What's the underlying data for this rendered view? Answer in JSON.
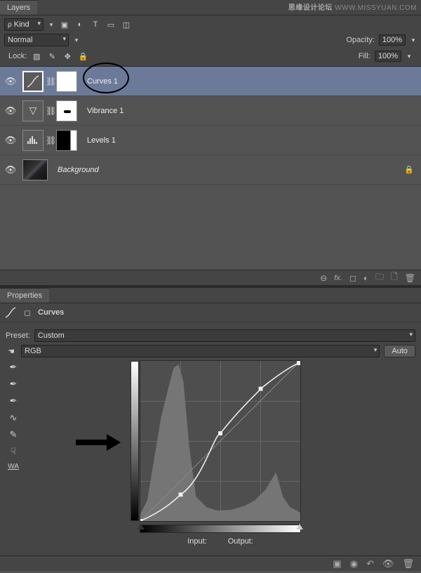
{
  "watermark": {
    "brand": "思缘设计论坛",
    "url": "WWW.MISSYUAN.COM"
  },
  "layers_panel": {
    "tab": "Layers",
    "kind_label": "Kind",
    "filter_icons": [
      "pixel-icon",
      "adjust-icon",
      "type-icon",
      "shape-icon",
      "smart-icon"
    ],
    "blend_mode": "Normal",
    "opacity_label": "Opacity:",
    "opacity_value": "100%",
    "lock_label": "Lock:",
    "fill_label": "Fill:",
    "fill_value": "100%",
    "items": [
      {
        "name": "Curves 1",
        "type": "curves",
        "visible": true,
        "selected": true
      },
      {
        "name": "Vibrance 1",
        "type": "vibrance",
        "visible": true,
        "selected": false
      },
      {
        "name": "Levels 1",
        "type": "levels",
        "visible": true,
        "selected": false
      },
      {
        "name": "Background",
        "type": "image",
        "visible": true,
        "selected": false,
        "locked": true,
        "italic": true
      }
    ],
    "footer_icons": [
      "link-icon",
      "fx-icon",
      "mask-icon",
      "adjustment-icon",
      "group-icon",
      "new-layer-icon",
      "trash-icon"
    ]
  },
  "properties_panel": {
    "tab": "Properties",
    "title": "Curves",
    "preset_label": "Preset:",
    "preset_value": "Custom",
    "channel_value": "RGB",
    "auto_label": "Auto",
    "input_label": "Input:",
    "output_label": "Output:",
    "tool_icons": [
      "target-adjust-icon",
      "sample-black-icon",
      "sample-gray-icon",
      "sample-white-icon",
      "edit-points-icon",
      "draw-curve-icon",
      "hand-icon",
      "clip-icon"
    ],
    "footer_icons": [
      "clip-toggle-icon",
      "view-previous-icon",
      "reset-icon",
      "visibility-icon",
      "trash-icon"
    ]
  },
  "chart_data": {
    "type": "line",
    "title": "Curves",
    "xlabel": "Input",
    "ylabel": "Output",
    "xlim": [
      0,
      255
    ],
    "ylim": [
      0,
      255
    ],
    "series": [
      {
        "name": "curve",
        "x": [
          0,
          64,
          128,
          192,
          255
        ],
        "y": [
          0,
          42,
          140,
          210,
          252
        ]
      },
      {
        "name": "baseline",
        "x": [
          0,
          255
        ],
        "y": [
          0,
          255
        ]
      }
    ],
    "sliders": {
      "black": 0,
      "white": 255
    }
  }
}
